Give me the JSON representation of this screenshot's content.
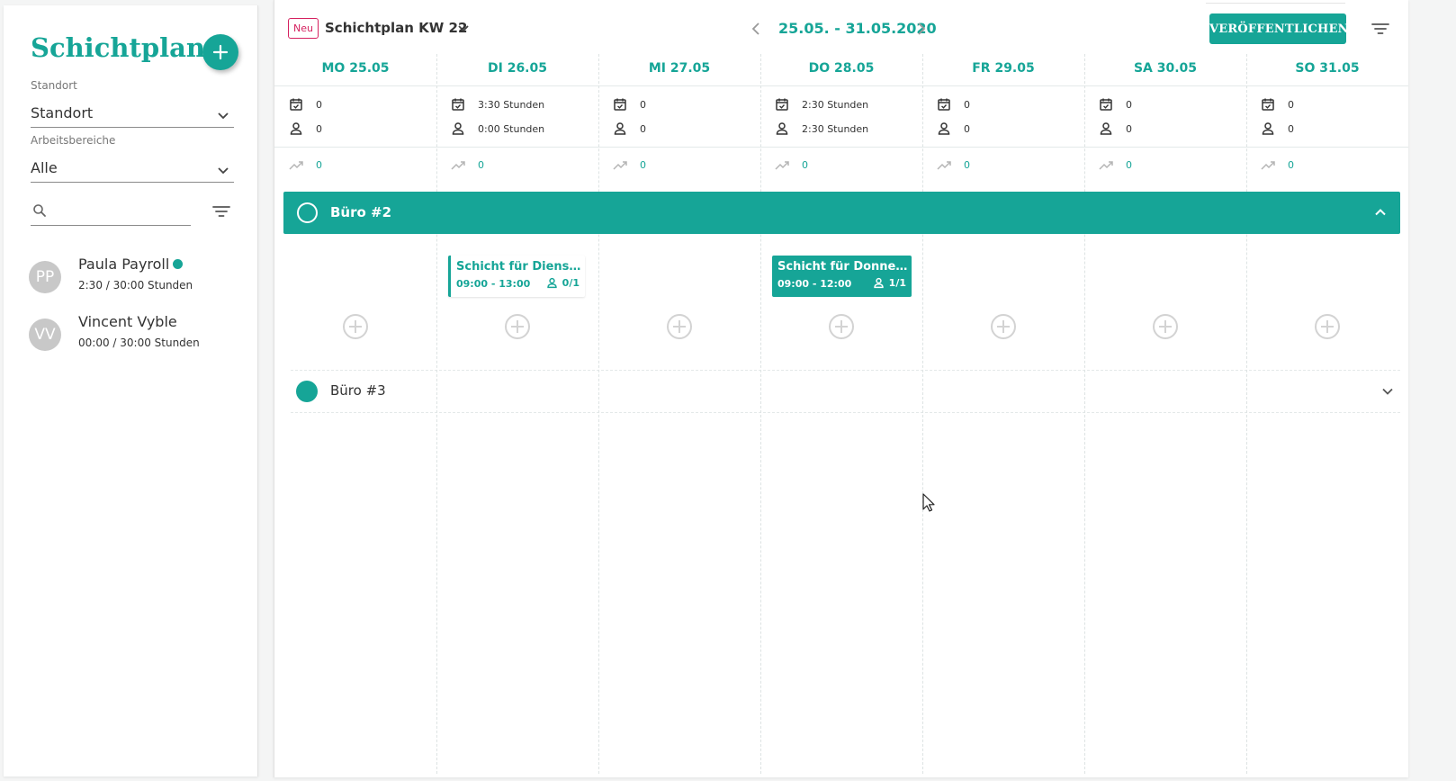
{
  "sidebar": {
    "title": "Schichtplan",
    "standort": {
      "label": "Standort",
      "value": "Standort"
    },
    "arbeitsbereiche": {
      "label": "Arbeitsbereiche",
      "value": "Alle"
    },
    "search": {
      "placeholder": ""
    },
    "employees": [
      {
        "initials": "PP",
        "name": "Paula Payroll",
        "hours": "2:30 / 30:00 Stunden",
        "online": true
      },
      {
        "initials": "VV",
        "name": "Vincent Vyble",
        "hours": "00:00 / 30:00 Stunden",
        "online": false
      }
    ]
  },
  "header": {
    "badge": "Neu",
    "plan_title": "Schichtplan KW 22",
    "date_range": "25.05. - 31.05.2020",
    "publish_label": "VERÖFFENTLICHEN"
  },
  "days": [
    {
      "label": "MO 25.05",
      "planned": "0",
      "assigned": "0",
      "trend": "0"
    },
    {
      "label": "DI 26.05",
      "planned": "3:30 Stunden",
      "assigned": "0:00 Stunden",
      "trend": "0"
    },
    {
      "label": "MI 27.05",
      "planned": "0",
      "assigned": "0",
      "trend": "0"
    },
    {
      "label": "DO 28.05",
      "planned": "2:30 Stunden",
      "assigned": "2:30 Stunden",
      "trend": "0"
    },
    {
      "label": "FR 29.05",
      "planned": "0",
      "assigned": "0",
      "trend": "0"
    },
    {
      "label": "SA 30.05",
      "planned": "0",
      "assigned": "0",
      "trend": "0"
    },
    {
      "label": "SO 31.05",
      "planned": "0",
      "assigned": "0",
      "trend": "0"
    }
  ],
  "groups": [
    {
      "name": "Büro #2",
      "expanded": true,
      "shifts": [
        {
          "day_index": 1,
          "title": "Schicht für Dienstag",
          "time": "09:00 - 13:00",
          "staff": "0/1",
          "style": "outline"
        },
        {
          "day_index": 3,
          "title": "Schicht für Donnerst...",
          "time": "09:00 - 12:00",
          "staff": "1/1",
          "style": "filled"
        }
      ]
    },
    {
      "name": "Büro #3",
      "expanded": false
    }
  ],
  "colors": {
    "accent": "#16a597",
    "badge": "#d5205f"
  },
  "icons": {
    "add": "plus-circle-icon",
    "calendar": "calendar-check-icon",
    "person": "person-icon",
    "trend": "trending-up-icon",
    "filter": "filter-icon",
    "search": "search-icon"
  }
}
